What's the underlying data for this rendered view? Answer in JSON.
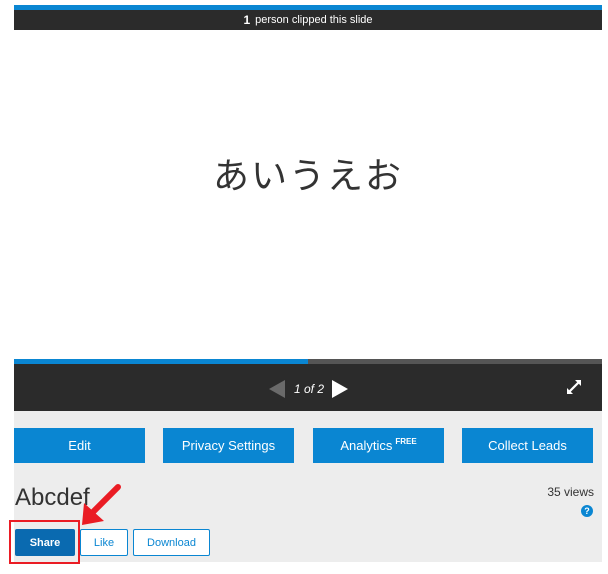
{
  "colors": {
    "accent": "#0a86d2",
    "highlight": "#ea1c24",
    "dark_bar": "#2b2b2b"
  },
  "clip_bar": {
    "count": "1",
    "text": "person clipped this slide"
  },
  "slide": {
    "text": "あいうえお"
  },
  "player": {
    "progress_fraction": 0.5,
    "page_indicator": "1 of 2",
    "fullscreen_icon": "expand-icon"
  },
  "actions": {
    "edit": "Edit",
    "privacy": "Privacy Settings",
    "analytics": "Analytics",
    "analytics_badge": "FREE",
    "collect_leads": "Collect Leads"
  },
  "presentation": {
    "title": "Abcdef",
    "views": "35 views",
    "help": "?"
  },
  "buttons": {
    "share": "Share",
    "like": "Like",
    "download": "Download"
  }
}
